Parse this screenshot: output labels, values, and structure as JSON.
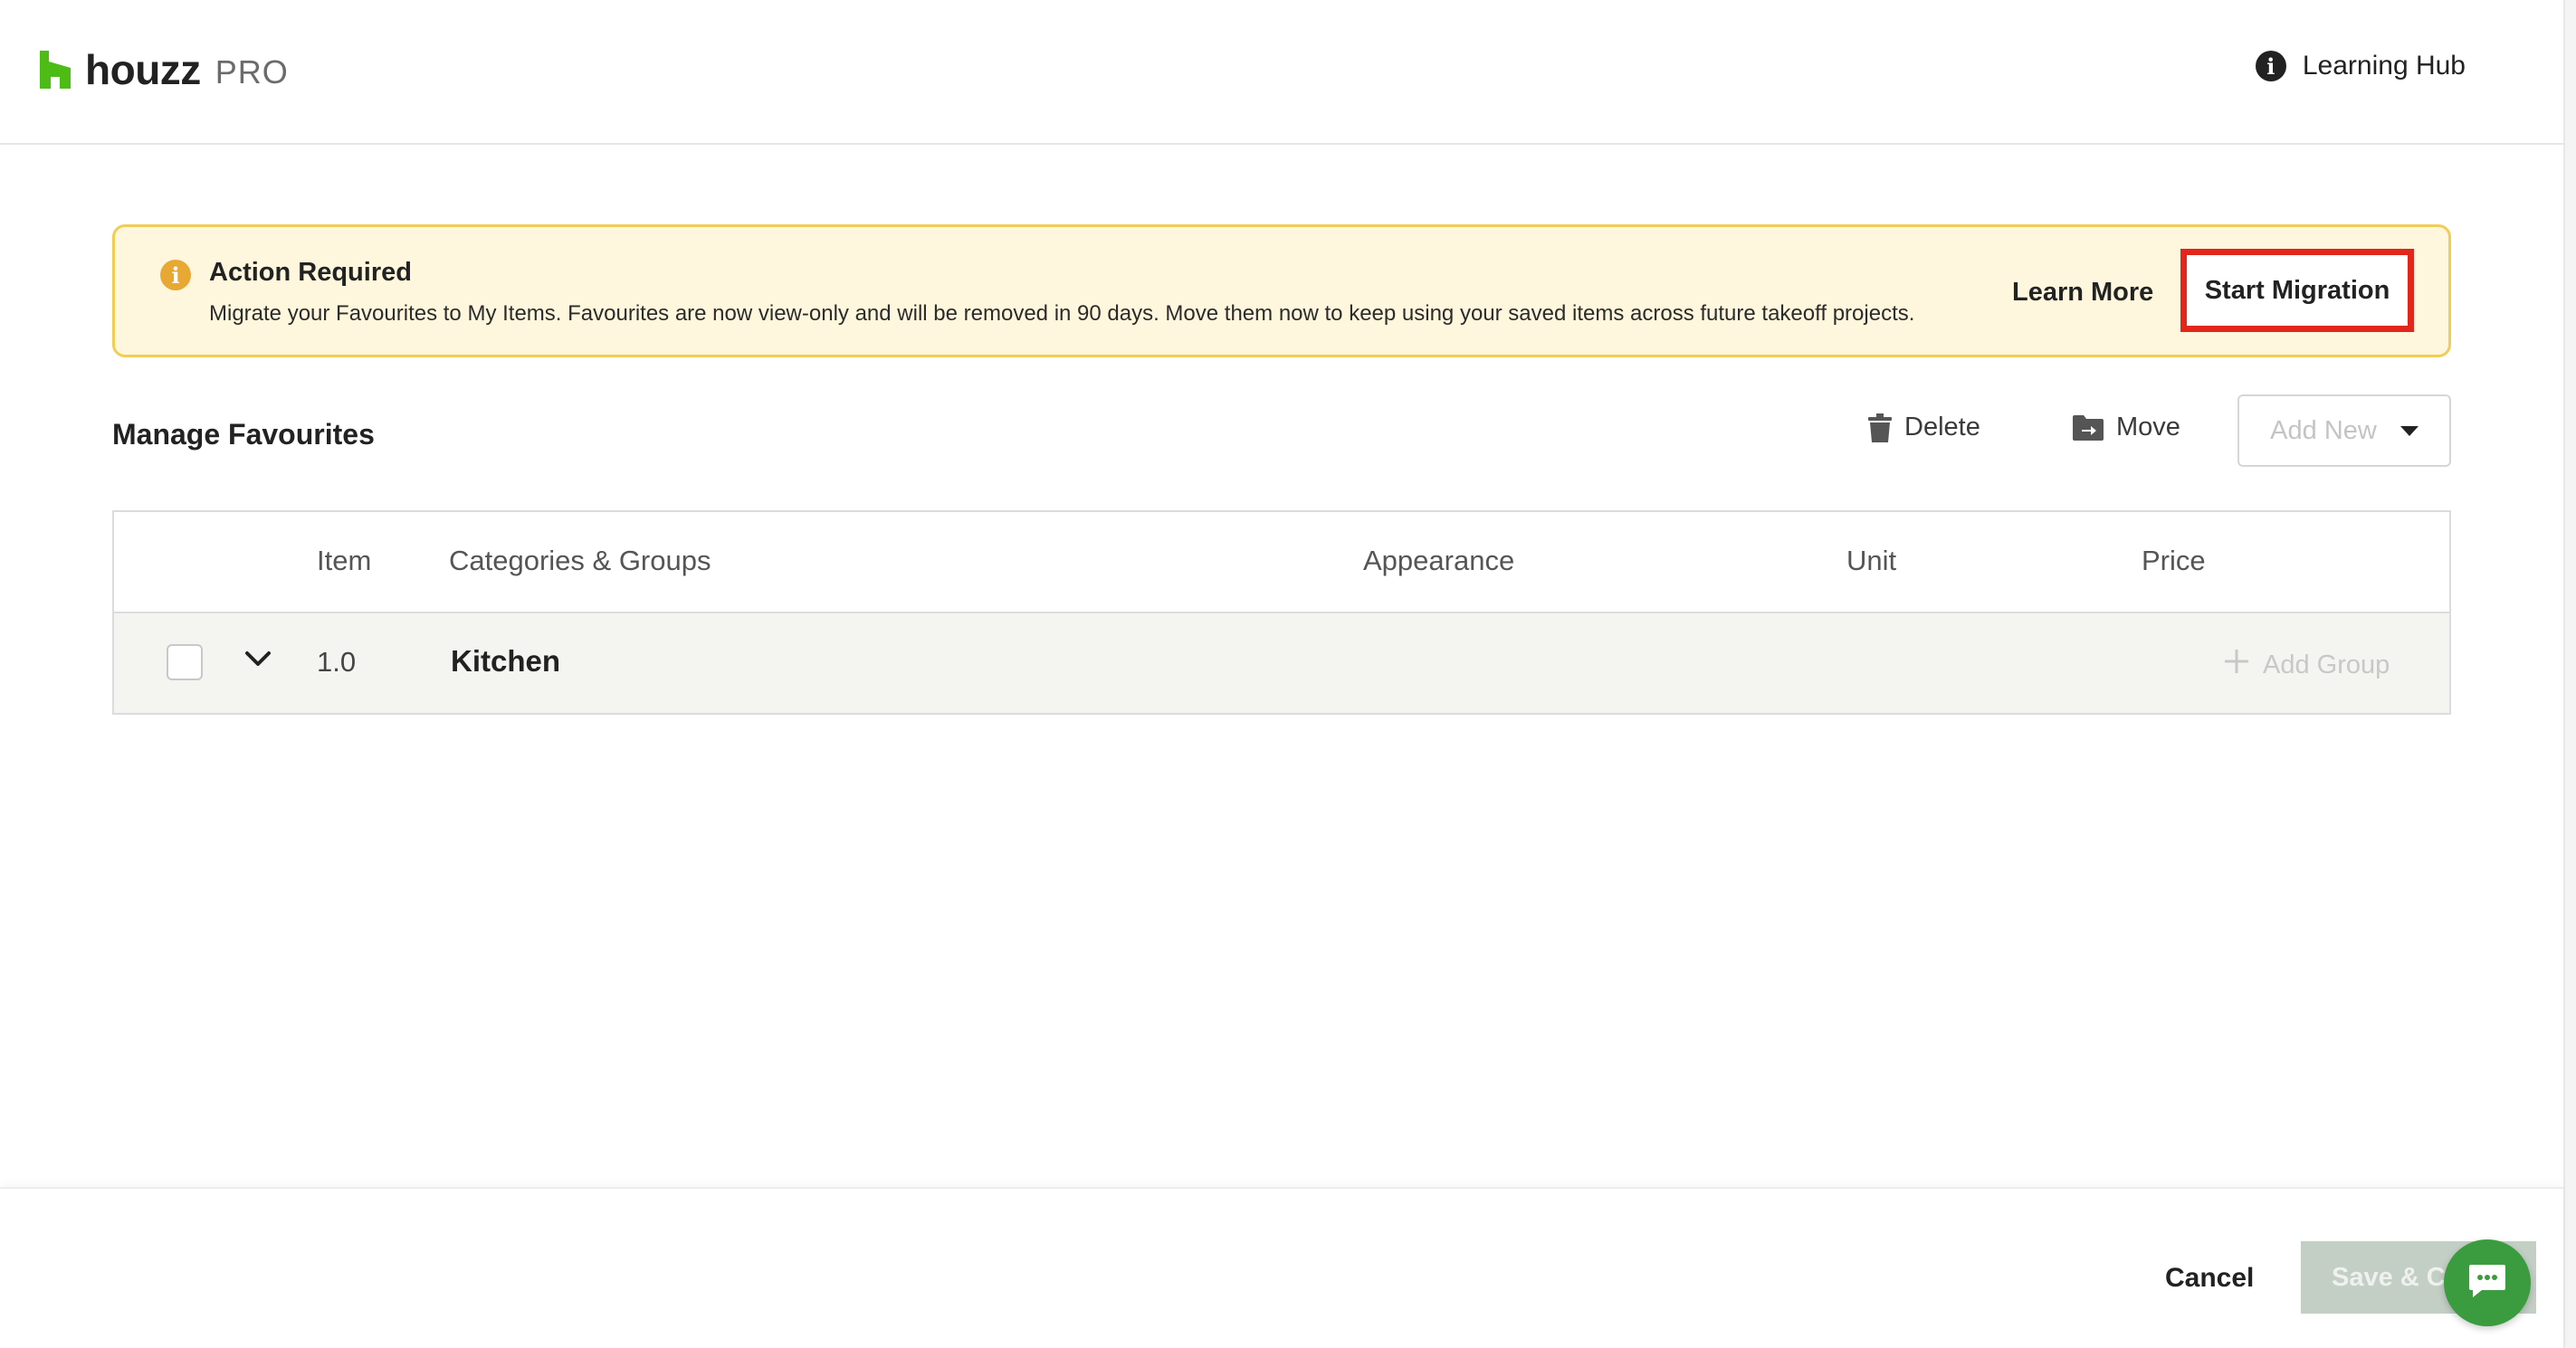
{
  "header": {
    "logo_text": "houzz",
    "logo_pro": "PRO",
    "learning_hub": "Learning Hub"
  },
  "banner": {
    "title": "Action Required",
    "message": "Migrate your Favourites to My Items. Favourites are now view-only and will be removed in 90 days. Move them now to keep using your saved items across future takeoff projects.",
    "learn_more": "Learn More",
    "start_migration": "Start Migration"
  },
  "toolbar": {
    "title": "Manage Favourites",
    "delete_label": "Delete",
    "move_label": "Move",
    "add_new_label": "Add New"
  },
  "table": {
    "headers": {
      "item": "Item",
      "categories": "Categories & Groups",
      "appearance": "Appearance",
      "unit": "Unit",
      "price": "Price"
    },
    "rows": [
      {
        "number": "1.0",
        "name": "Kitchen",
        "add_group": "Add Group"
      }
    ]
  },
  "footer": {
    "cancel": "Cancel",
    "save": "Save & Cl"
  },
  "colors": {
    "brand_green": "#4dbc15",
    "banner_bg": "#fef7dd",
    "banner_border": "#f2cd55",
    "highlight_red": "#e3261c",
    "chat_green": "#3a9b3f"
  },
  "icons": [
    "houzz-logo-icon",
    "info-icon",
    "warning-info-icon",
    "trash-icon",
    "folder-move-icon",
    "caret-down-icon",
    "chevron-down-icon",
    "plus-icon",
    "chat-icon"
  ]
}
